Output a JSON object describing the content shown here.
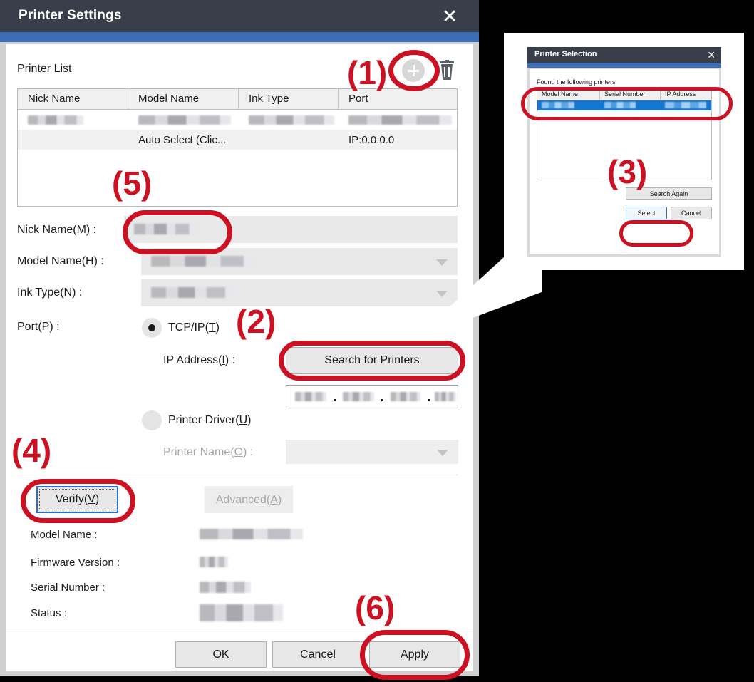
{
  "main_dialog": {
    "title": "Printer Settings",
    "close_label": "✕",
    "printer_list_label": "Printer List",
    "table": {
      "headers": [
        "Nick Name",
        "Model Name",
        "Ink Type",
        "Port"
      ],
      "rows": [
        {
          "nick_name": "",
          "model_name": "",
          "ink_type": "",
          "port": "",
          "redacted": true
        },
        {
          "nick_name": "",
          "model_name": "Auto Select (Clic...",
          "ink_type": "",
          "port": "IP:0.0.0.0",
          "redacted": false
        }
      ]
    },
    "fields": {
      "nick_name_label": "Nick Name(M) :",
      "nick_name_value": "",
      "model_name_label": "Model Name(H) :",
      "model_name_value": "",
      "ink_type_label": "Ink Type(N) :",
      "ink_type_value": "",
      "port_label": "Port(P) :"
    },
    "port_options": {
      "tcpip_label": "TCP/IP(T)",
      "tcpip_mnemonic": "T",
      "tcpip_selected": true,
      "ip_address_label": "IP Address(I) :",
      "search_button": "Search for Printers",
      "ip_value": "",
      "printer_driver_label": "Printer Driver(U)",
      "printer_driver_mnemonic": "U",
      "printer_driver_selected": false,
      "printer_name_label": "Printer Name(O) :",
      "printer_name_value": ""
    },
    "actions": {
      "verify_label": "Verify(V)",
      "verify_mnemonic": "V",
      "advanced_label": "Advanced(A)",
      "advanced_mnemonic": "A",
      "advanced_disabled": true
    },
    "info": {
      "model_name_label": "Model Name :",
      "model_name_value": "",
      "firmware_version_label": "Firmware Version :",
      "firmware_version_value": "",
      "serial_number_label": "Serial Number :",
      "serial_number_value": "",
      "status_label": "Status :",
      "status_value": ""
    },
    "footer": {
      "ok_label": "OK",
      "cancel_label": "Cancel",
      "apply_label": "Apply"
    }
  },
  "inset_dialog": {
    "title": "Printer Selection",
    "close_label": "✕",
    "found_text": "Found the following printers",
    "table": {
      "headers": [
        "Model Name",
        "Serial Number",
        "IP Address"
      ],
      "rows": [
        {
          "model_name": "",
          "serial_number": "",
          "ip_address": "",
          "selected": true
        }
      ]
    },
    "search_again_label": "Search Again",
    "select_label": "Select",
    "cancel_label": "Cancel"
  },
  "annotations": {
    "step1": "(1)",
    "step2": "(2)",
    "step3": "(3)",
    "step4": "(4)",
    "step5": "(5)",
    "step6": "(6)"
  },
  "colors": {
    "titlebar": "#383f4a",
    "accent_blue": "#3b6eb4",
    "annotation_red": "#cc1122",
    "selection_blue": "#1576d0",
    "focus_blue": "#2d6fc4",
    "background": "#000000"
  }
}
